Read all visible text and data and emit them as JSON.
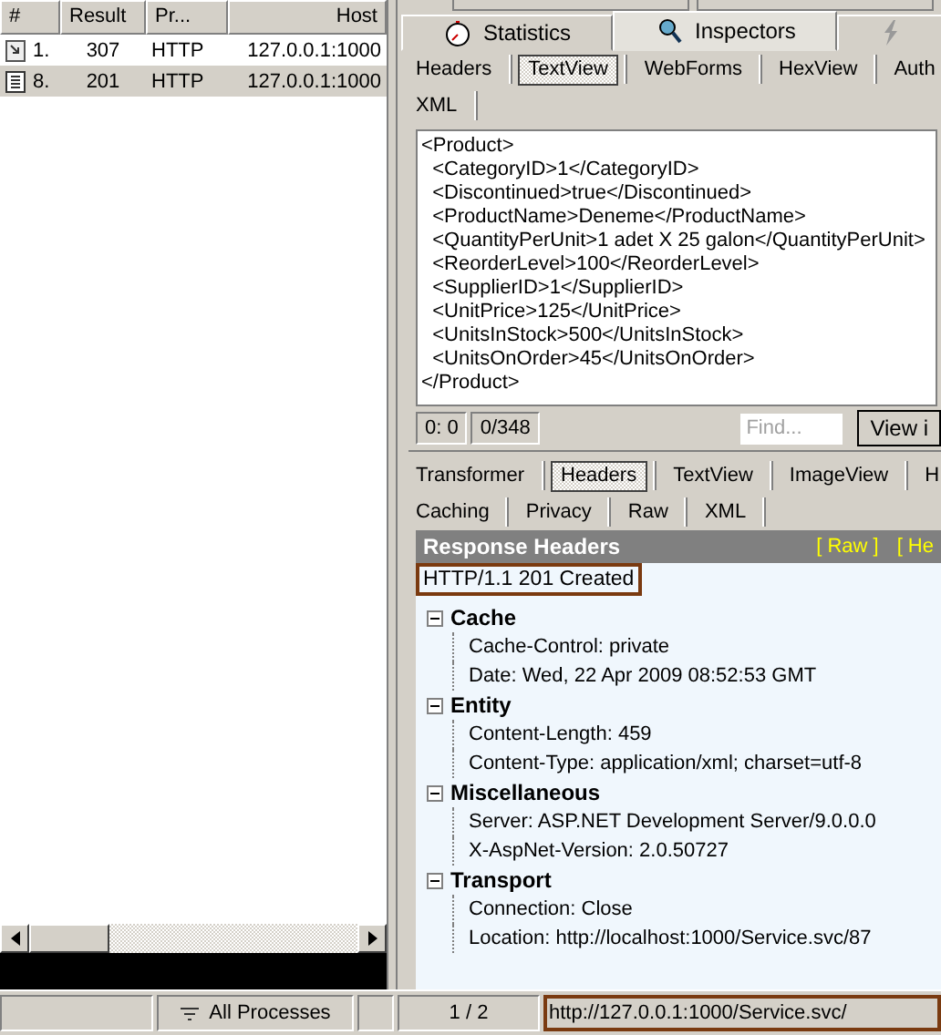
{
  "sessions": {
    "columns": [
      "#",
      "Result",
      "Pr...",
      "Host"
    ],
    "rows": [
      {
        "kind": "redirect",
        "number": "1.",
        "result": "307",
        "protocol": "HTTP",
        "host": "127.0.0.1:1000",
        "selected": false
      },
      {
        "kind": "document",
        "number": "8.",
        "result": "201",
        "protocol": "HTTP",
        "host": "127.0.0.1:1000",
        "selected": true
      }
    ]
  },
  "main_tabs": [
    {
      "label": "Statistics",
      "kind": "stopwatch",
      "selected": false
    },
    {
      "label": "Inspectors",
      "kind": "inspector",
      "selected": true
    },
    {
      "kind": "lightning",
      "selected": false
    }
  ],
  "request_tabs": [
    [
      {
        "label": "Headers",
        "selected": false
      },
      {
        "label": "TextView",
        "selected": true
      },
      {
        "label": "WebForms",
        "selected": false
      },
      {
        "label": "HexView",
        "selected": false
      },
      {
        "label": "Auth",
        "selected": false
      }
    ],
    [
      {
        "label": "XML",
        "selected": false
      }
    ]
  ],
  "request_body": [
    "<Product>",
    "  <CategoryID>1</CategoryID>",
    "  <Discontinued>true</Discontinued>",
    "  <ProductName>Deneme</ProductName>",
    "  <QuantityPerUnit>1 adet X 25 galon</QuantityPerUnit>",
    "  <ReorderLevel>100</ReorderLevel>",
    "  <SupplierID>1</SupplierID>",
    "  <UnitPrice>125</UnitPrice>",
    "  <UnitsInStock>500</UnitsInStock>",
    "  <UnitsOnOrder>45</UnitsOnOrder>",
    "</Product>"
  ],
  "text_status": {
    "position": "0: 0",
    "count": "0/348",
    "find_placeholder": "Find...",
    "view_button": "View i"
  },
  "response_tabs": [
    [
      {
        "label": "Transformer",
        "selected": false
      },
      {
        "label": "Headers",
        "selected": true
      },
      {
        "label": "TextView",
        "selected": false
      },
      {
        "label": "ImageView",
        "selected": false
      },
      {
        "label": "H",
        "selected": false
      }
    ],
    [
      {
        "label": "Caching",
        "selected": false
      },
      {
        "label": "Privacy",
        "selected": false
      },
      {
        "label": "Raw",
        "selected": false
      },
      {
        "label": "XML",
        "selected": false
      }
    ]
  ],
  "response_headers": {
    "title": "Response Headers",
    "links": [
      "[ Raw ]",
      "[ He"
    ],
    "status_line": "HTTP/1.1 201 Created",
    "groups": [
      {
        "name": "Cache",
        "expanded": true,
        "children": [
          "Cache-Control: private",
          "Date: Wed, 22 Apr 2009 08:52:53 GMT"
        ]
      },
      {
        "name": "Entity",
        "expanded": true,
        "children": [
          "Content-Length: 459",
          "Content-Type: application/xml; charset=utf-8"
        ]
      },
      {
        "name": "Miscellaneous",
        "expanded": true,
        "children": [
          "Server: ASP.NET Development Server/9.0.0.0",
          "X-AspNet-Version: 2.0.50727"
        ]
      },
      {
        "name": "Transport",
        "expanded": true,
        "children": [
          "Connection: Close",
          "Location: http://localhost:1000/Service.svc/87"
        ]
      }
    ]
  },
  "status_bar": {
    "process_filter": "All Processes",
    "session_count": "1 / 2",
    "url": "http://127.0.0.1:1000/Service.svc/"
  }
}
